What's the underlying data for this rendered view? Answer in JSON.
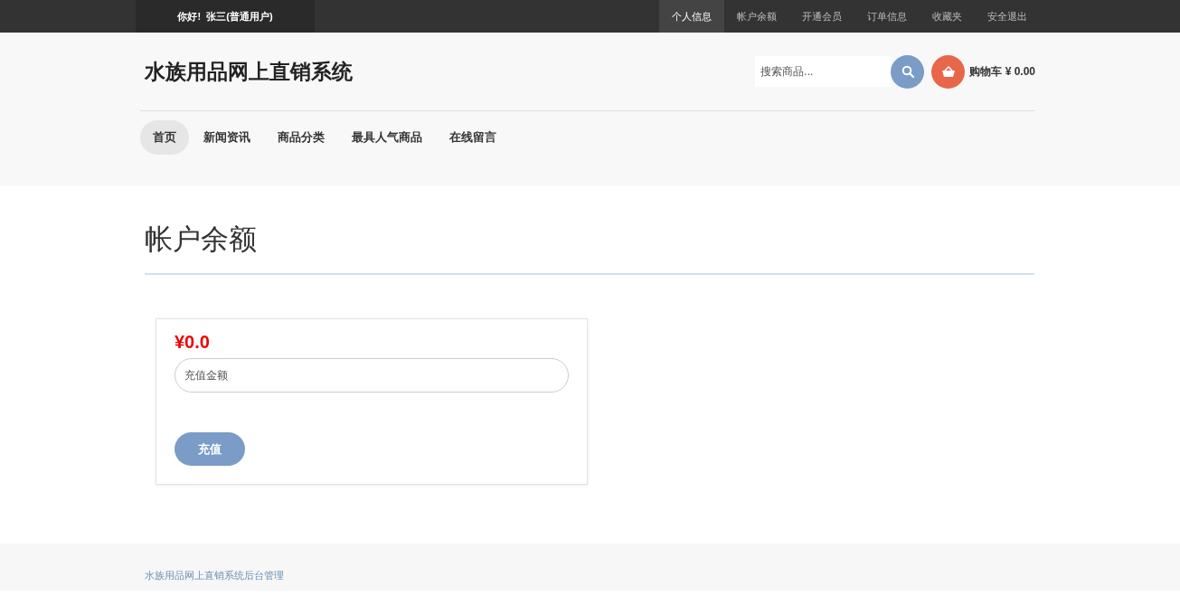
{
  "top_bar": {
    "greeting": "你好!  张三(普通用户)",
    "links": [
      {
        "label": "个人信息",
        "selected": true
      },
      {
        "label": "帐户余额",
        "selected": false
      },
      {
        "label": "开通会员",
        "selected": false
      },
      {
        "label": "订单信息",
        "selected": false
      },
      {
        "label": "收藏夹",
        "selected": false
      },
      {
        "label": "安全退出",
        "selected": false
      }
    ]
  },
  "header": {
    "site_title": "水族用品网上直销系统",
    "search": {
      "placeholder": "搜索商品..."
    },
    "cart": {
      "label": "购物车",
      "total": "¥ 0.00"
    }
  },
  "nav": [
    {
      "label": "首页",
      "selected": true
    },
    {
      "label": "新闻资讯",
      "selected": false
    },
    {
      "label": "商品分类",
      "selected": false
    },
    {
      "label": "最具人气商品",
      "selected": false
    },
    {
      "label": "在线留言",
      "selected": false
    }
  ],
  "page_title": "帐户余额",
  "balance_card": {
    "balance": "¥0.0",
    "amount_field": {
      "placeholder": "充值金额"
    },
    "submit_button": "充值"
  },
  "footer": {
    "link": "水族用品网上直销系统后台管理"
  }
}
